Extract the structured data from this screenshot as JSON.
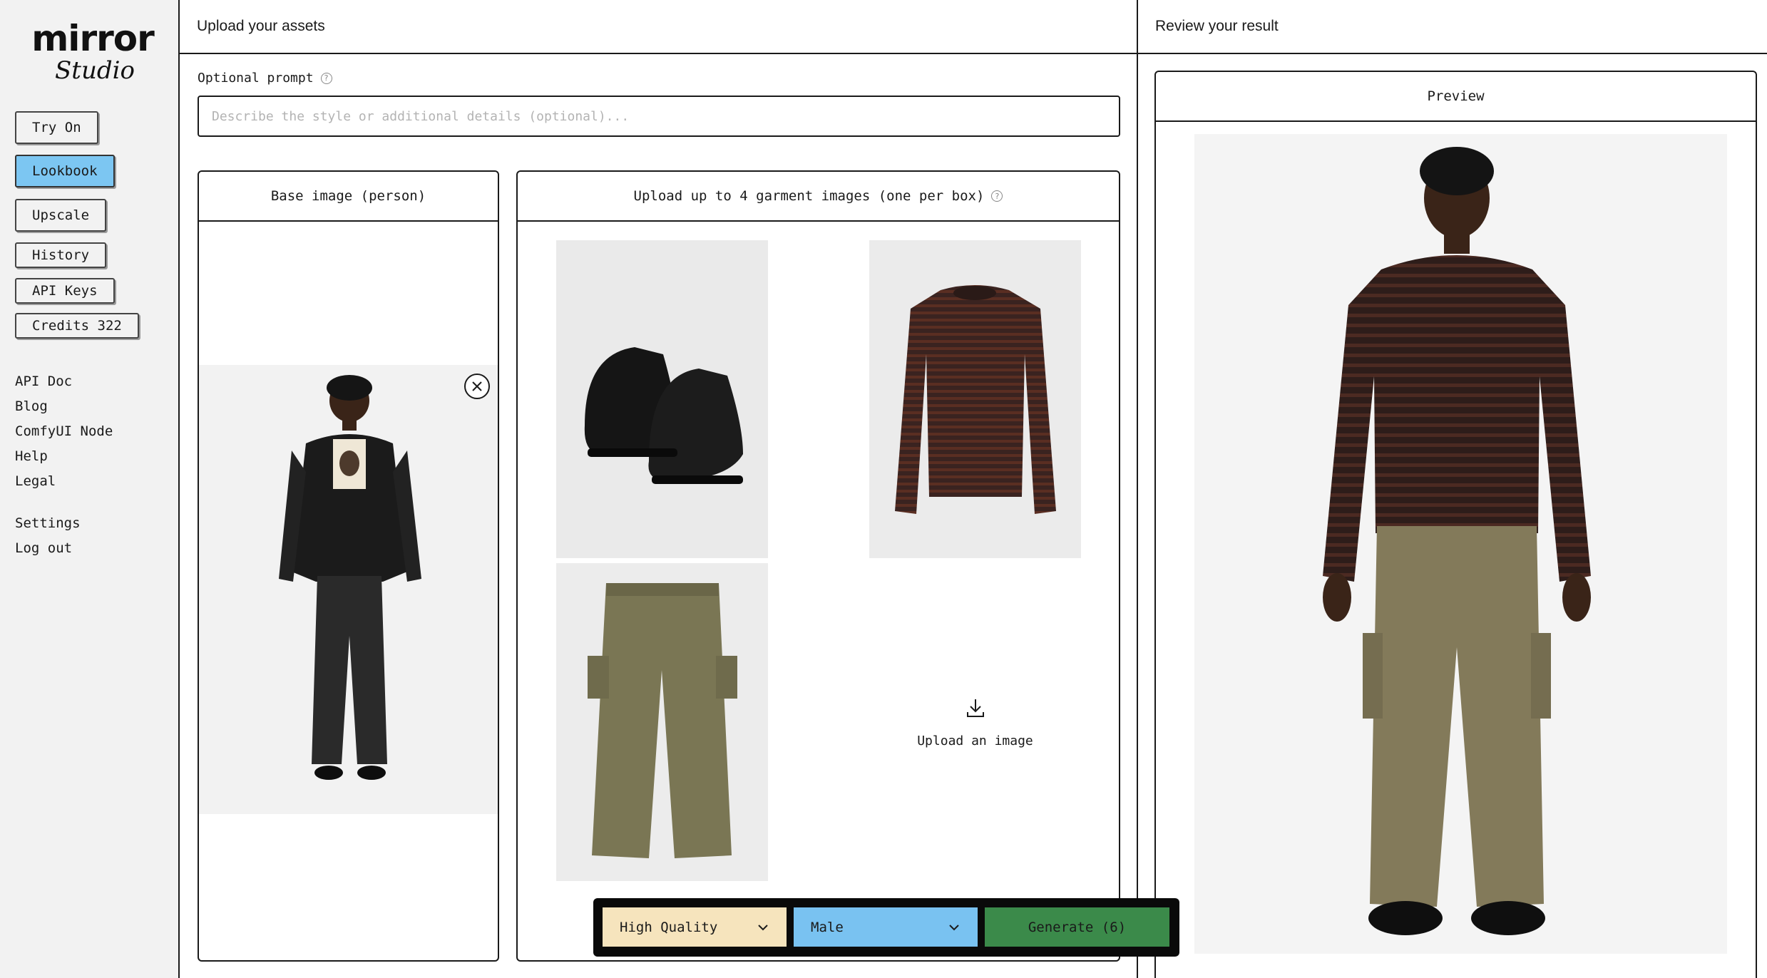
{
  "brand": {
    "name": "mirror",
    "subtitle": "Studio"
  },
  "sidebar": {
    "buttons": [
      {
        "label": "Try On",
        "active": false
      },
      {
        "label": "Lookbook",
        "active": true
      },
      {
        "label": "Upscale",
        "active": false
      },
      {
        "label": "History",
        "active": false
      },
      {
        "label": "API Keys",
        "active": false
      },
      {
        "label": "Credits 322",
        "active": false
      }
    ],
    "links": [
      "API Doc",
      "Blog",
      "ComfyUI Node",
      "Help",
      "Legal"
    ],
    "account_links": [
      "Settings",
      "Log out"
    ]
  },
  "upload_section": {
    "title": "Upload your assets"
  },
  "review_section": {
    "title": "Review your result",
    "preview_label": "Preview"
  },
  "prompt": {
    "label": "Optional prompt",
    "value": "",
    "placeholder": "Describe the style or additional details (optional)..."
  },
  "base_panel": {
    "title": "Base image (person)"
  },
  "garment_panel": {
    "title": "Upload up to 4 garment images (one per box)",
    "upload_label": "Upload an image"
  },
  "toolbar": {
    "quality": "High Quality",
    "gender": "Male",
    "generate_label": "Generate (6)"
  },
  "colors": {
    "active_button": "#7cc6f2",
    "quality_bg": "#f6e4bd",
    "gender_bg": "#79c2f1",
    "generate_bg": "#3b8a4a"
  }
}
